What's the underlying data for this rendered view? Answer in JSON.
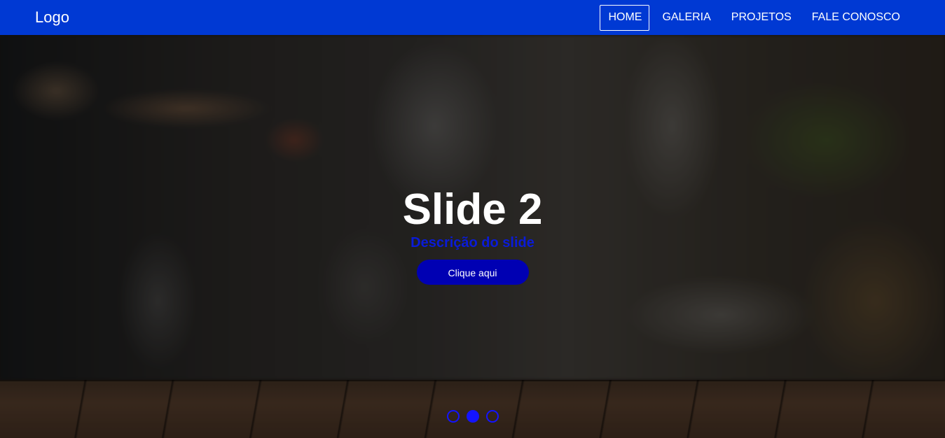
{
  "header": {
    "logo": "Logo",
    "nav": [
      {
        "label": "HOME",
        "active": true
      },
      {
        "label": "GALERIA",
        "active": false
      },
      {
        "label": "PROJETOS",
        "active": false
      },
      {
        "label": "FALE CONOSCO",
        "active": false
      }
    ]
  },
  "slide": {
    "title": "Slide 2",
    "description": "Descrição do slide",
    "button_label": "Clique aqui"
  },
  "carousel": {
    "total_slides": 3,
    "active_index": 1
  },
  "colors": {
    "header_bg": "#0039d3",
    "button_bg": "#0000b3",
    "description_text": "#0a1bd8",
    "dot": "#1414ff"
  }
}
